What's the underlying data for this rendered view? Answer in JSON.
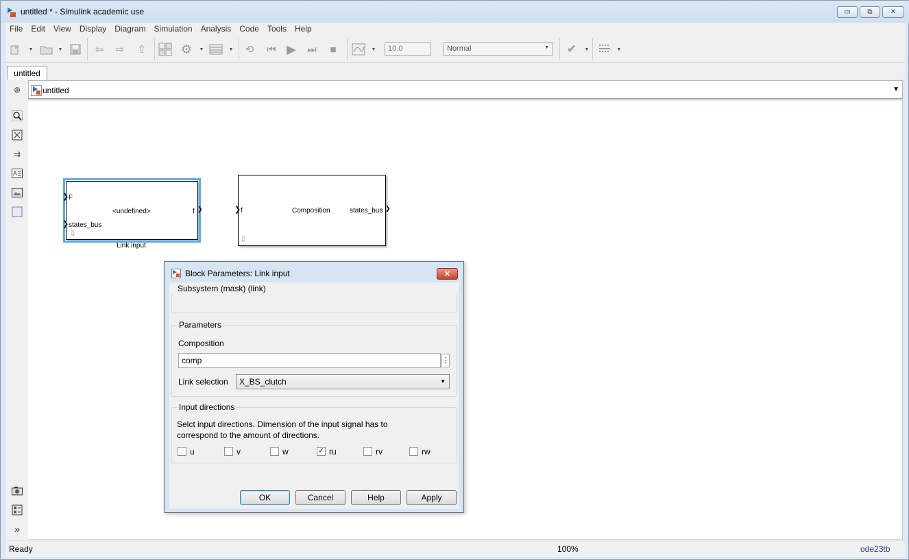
{
  "window": {
    "title": "untitled * - Simulink academic use",
    "minimize_glyph": "▭",
    "maximize_glyph": "⧉",
    "close_glyph": "✕"
  },
  "menu": {
    "items": [
      {
        "label": "File"
      },
      {
        "label": "Edit"
      },
      {
        "label": "View"
      },
      {
        "label": "Display"
      },
      {
        "label": "Diagram"
      },
      {
        "label": "Simulation"
      },
      {
        "label": "Analysis"
      },
      {
        "label": "Code"
      },
      {
        "label": "Tools"
      },
      {
        "label": "Help"
      }
    ]
  },
  "toolbar": {
    "stop_time": "10.0",
    "sim_mode": "Normal",
    "icons": [
      "new-model-icon",
      "open-icon",
      "save-icon",
      "back-icon",
      "forward-icon",
      "up-icon",
      "library-browser-icon",
      "model-settings-icon",
      "model-explorer-icon",
      "step-back-icon",
      "run-icon",
      "step-forward-icon",
      "stop-icon",
      "scope-icon",
      "check-icon",
      "build-icon"
    ]
  },
  "tabs": [
    {
      "label": "untitled"
    }
  ],
  "addressbar": {
    "path": "untitled"
  },
  "palette": {
    "icons": [
      "nav-back-icon",
      "zoom-icon",
      "fit-view-icon",
      "route-lines-icon",
      "annotation-icon",
      "image-icon",
      "area-icon",
      "screenshot-icon",
      "report-icon",
      "expand-icon"
    ]
  },
  "canvas": {
    "blocks": [
      {
        "caption": "Link input",
        "center_label": "<undefined>",
        "inputs": [
          "F",
          "states_bus"
        ],
        "outputs": [
          "f"
        ]
      },
      {
        "caption": "",
        "center_label": "Composition",
        "inputs": [
          "f"
        ],
        "outputs": [
          "states_bus"
        ]
      }
    ]
  },
  "status": {
    "left": "Ready",
    "zoom": "100%",
    "solver": "ode23tb"
  },
  "dialog": {
    "title": "Block Parameters: Link input",
    "subsystem_group": "Subsystem (mask) (link)",
    "parameters_group": "Parameters",
    "composition_label": "Composition",
    "composition_value": "comp",
    "link_selection_label": "Link selection",
    "link_selection_value": "X_BS_clutch",
    "input_directions_group": "Input directions",
    "input_directions_desc_1": "Selct input directions. Dimension of the input signal has to",
    "input_directions_desc_2": "correspond to the amount of directions.",
    "checkboxes": [
      {
        "label": "u",
        "checked": false
      },
      {
        "label": "v",
        "checked": false
      },
      {
        "label": "w",
        "checked": false
      },
      {
        "label": "ru",
        "checked": true
      },
      {
        "label": "rv",
        "checked": false
      },
      {
        "label": "rw",
        "checked": false
      }
    ],
    "buttons": {
      "ok": "OK",
      "cancel": "Cancel",
      "help": "Help",
      "apply": "Apply"
    }
  }
}
